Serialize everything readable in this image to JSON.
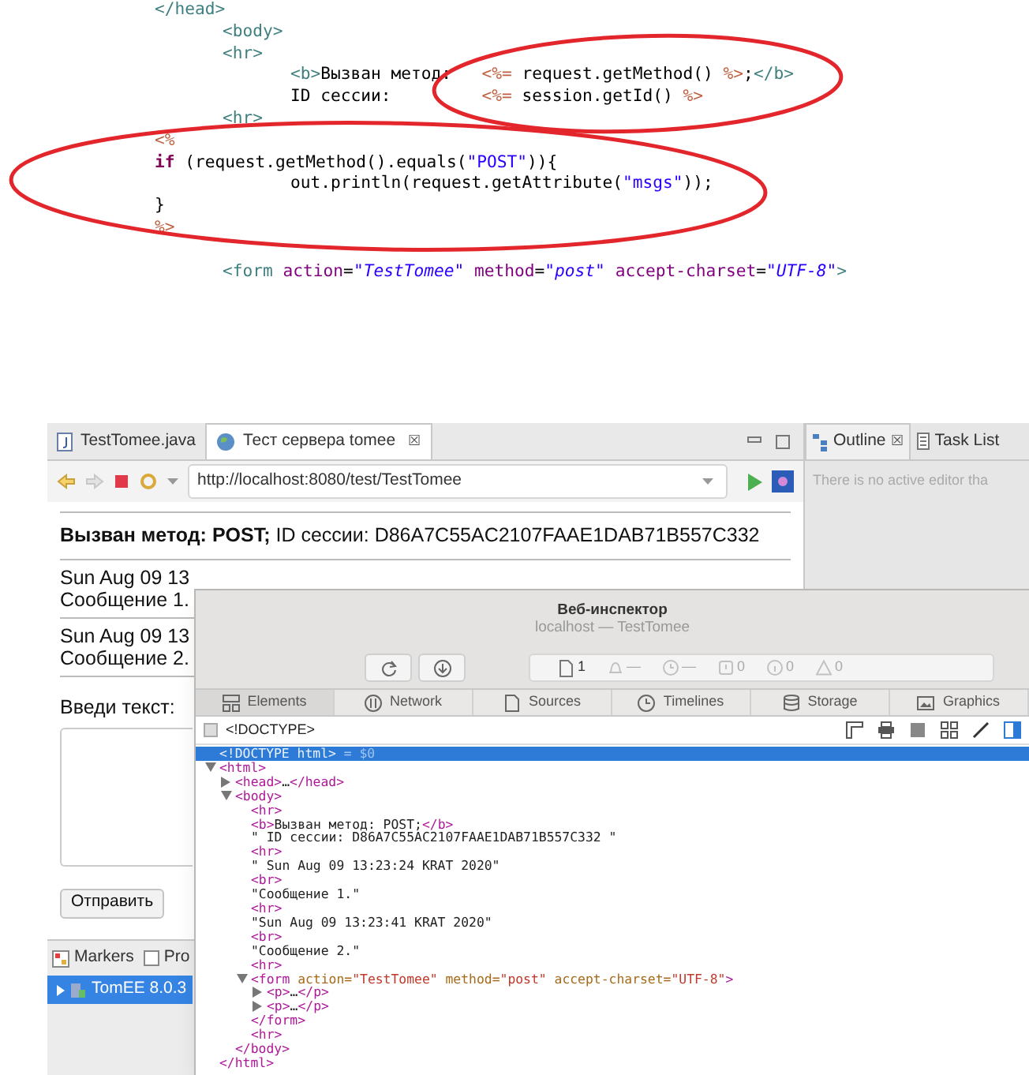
{
  "code_listing": {
    "lines": [
      {
        "tokens": [
          {
            "kind": "tag",
            "text": "</head>"
          }
        ]
      },
      {
        "tokens": [
          {
            "kind": "tag",
            "text": "\t<body>"
          }
        ]
      },
      {
        "tokens": [
          {
            "kind": "tag",
            "text": "\t<hr>"
          }
        ]
      },
      {
        "tokens": [
          {
            "kind": "tag",
            "text": "\t\t<b>"
          },
          {
            "kind": "plain",
            "text": "Вызван метод:   "
          },
          {
            "kind": "jsp",
            "text": "<%="
          },
          {
            "kind": "plain",
            "text": " request.getMethod() "
          },
          {
            "kind": "jsp",
            "text": "%>"
          },
          {
            "kind": "plain",
            "text": ";"
          },
          {
            "kind": "tag",
            "text": "</b>"
          }
        ]
      },
      {
        "tokens": [
          {
            "kind": "plain",
            "text": "\t\tID сессии:         "
          },
          {
            "kind": "jsp",
            "text": "<%="
          },
          {
            "kind": "plain",
            "text": " session.getId() "
          },
          {
            "kind": "jsp",
            "text": "%>"
          }
        ]
      },
      {
        "tokens": [
          {
            "kind": "tag",
            "text": "\t<hr>"
          }
        ]
      },
      {
        "tokens": [
          {
            "kind": "jsp",
            "text": "<%"
          }
        ]
      },
      {
        "tokens": [
          {
            "kind": "keyword",
            "text": "if"
          },
          {
            "kind": "plain",
            "text": " (request.getMethod().equals("
          },
          {
            "kind": "string",
            "text": "\"POST\""
          },
          {
            "kind": "plain",
            "text": ")){"
          }
        ]
      },
      {
        "tokens": [
          {
            "kind": "plain",
            "text": "\t\tout.println(request.getAttribute("
          },
          {
            "kind": "string",
            "text": "\"msgs\""
          },
          {
            "kind": "plain",
            "text": "));"
          }
        ]
      },
      {
        "tokens": [
          {
            "kind": "plain",
            "text": "}"
          }
        ]
      },
      {
        "tokens": [
          {
            "kind": "jsp",
            "text": "%>"
          }
        ]
      },
      {
        "gap_before": true,
        "tokens": [
          {
            "kind": "tag",
            "text": "\t<form"
          },
          {
            "kind": "attr",
            "text": " action"
          },
          {
            "kind": "plain",
            "text": "="
          },
          {
            "kind": "value",
            "text": "\"TestTomee\""
          },
          {
            "kind": "attr",
            "text": " method"
          },
          {
            "kind": "plain",
            "text": "="
          },
          {
            "kind": "value",
            "text": "\"post\""
          },
          {
            "kind": "attr",
            "text": " accept-charset"
          },
          {
            "kind": "plain",
            "text": "="
          },
          {
            "kind": "value",
            "text": "\"UTF-8\""
          },
          {
            "kind": "tag",
            "text": ">"
          }
        ]
      }
    ]
  },
  "editor": {
    "tabs": [
      {
        "label": "TestTomee.java",
        "selected": false
      },
      {
        "label": "Тест сервера tomee",
        "selected": true,
        "close": "☒"
      }
    ],
    "url": "http://localhost:8080/test/TestTomee",
    "page": {
      "heading": "**Вызван метод: POST;** ID сессии: D86A7C55AC2107FAAE1DAB71B557C332",
      "messages": [
        {
          "date": "Sun Aug 09 13",
          "text": "Сообщение 1."
        },
        {
          "date": "Sun Aug 09 13",
          "text": "Сообщение 2."
        }
      ],
      "input_label": "Введи текст:",
      "submit": "Отправить"
    }
  },
  "side_panel": {
    "tabs": [
      {
        "label": "Outline",
        "selected": true,
        "close": "☒"
      },
      {
        "label": "Task List",
        "selected": false
      }
    ],
    "message": "There is no active editor tha"
  },
  "bottom_panel": {
    "tabs": [
      {
        "label": "Markers"
      },
      {
        "label": "Pro"
      }
    ],
    "rows": [
      {
        "label": "TomEE 8.0.3",
        "selected": true
      }
    ]
  },
  "inspector": {
    "title": "Веб-инспектор",
    "subtitle": "localhost — TestTomee",
    "status": [
      {
        "kind": "doc",
        "text": "1",
        "dim": false
      },
      {
        "kind": "bell",
        "text": "—",
        "dim": true
      },
      {
        "kind": "clock",
        "text": "—",
        "dim": true
      },
      {
        "kind": "error",
        "text": "0",
        "dim": true
      },
      {
        "kind": "info",
        "text": "0",
        "dim": true
      },
      {
        "kind": "warn",
        "text": "0",
        "dim": true
      }
    ],
    "tabs": [
      {
        "label": "Elements",
        "selected": true
      },
      {
        "label": "Network",
        "selected": false
      },
      {
        "label": "Sources",
        "selected": false
      },
      {
        "label": "Timelines",
        "selected": false
      },
      {
        "label": "Storage",
        "selected": false
      },
      {
        "label": "Graphics",
        "selected": false
      }
    ],
    "breadcrumb": "<!DOCTYPE>",
    "tree": [
      {
        "selected": true,
        "tokens": [
          {
            "kind": "tag",
            "text": "<!DOCTYPE html>"
          },
          {
            "kind": "note",
            "text": " = $0"
          }
        ]
      },
      {
        "selected": false,
        "expanded": true,
        "tokens": [
          {
            "kind": "tag",
            "text": "<html>"
          }
        ],
        "closing": "</html>",
        "children": [
          {
            "selected": false,
            "expanded": false,
            "tokens": [
              {
                "kind": "tag",
                "text": "<head>"
              },
              {
                "kind": "text",
                "text": "…"
              },
              {
                "kind": "tag",
                "text": "</head>"
              }
            ]
          },
          {
            "selected": false,
            "expanded": true,
            "tokens": [
              {
                "kind": "tag",
                "text": "<body>"
              }
            ],
            "closing": "</body>",
            "children": [
              {
                "selected": false,
                "tokens": [
                  {
                    "kind": "tag",
                    "text": "<hr>"
                  }
                ]
              },
              {
                "selected": false,
                "tokens": [
                  {
                    "kind": "tag",
                    "text": "<b>"
                  },
                  {
                    "kind": "text",
                    "text": "Вызван метод: POST;"
                  },
                  {
                    "kind": "tag",
                    "text": "</b>"
                  }
                ]
              },
              {
                "selected": false,
                "tokens": [
                  {
                    "kind": "text",
                    "text": "\" ID сессии: D86A7C55AC2107FAAE1DAB71B557C332 \""
                  }
                ]
              },
              {
                "selected": false,
                "tokens": [
                  {
                    "kind": "tag",
                    "text": "<hr>"
                  }
                ]
              },
              {
                "selected": false,
                "tokens": [
                  {
                    "kind": "text",
                    "text": "\" Sun Aug 09 13:23:24 KRAT 2020\""
                  }
                ]
              },
              {
                "selected": false,
                "tokens": [
                  {
                    "kind": "tag",
                    "text": "<br>"
                  }
                ]
              },
              {
                "selected": false,
                "tokens": [
                  {
                    "kind": "text",
                    "text": "\"Сообщение 1.\""
                  }
                ]
              },
              {
                "selected": false,
                "tokens": [
                  {
                    "kind": "tag",
                    "text": "<hr>"
                  }
                ]
              },
              {
                "selected": false,
                "tokens": [
                  {
                    "kind": "text",
                    "text": "\"Sun Aug 09 13:23:41 KRAT 2020\""
                  }
                ]
              },
              {
                "selected": false,
                "tokens": [
                  {
                    "kind": "tag",
                    "text": "<br>"
                  }
                ]
              },
              {
                "selected": false,
                "tokens": [
                  {
                    "kind": "text",
                    "text": "\"Сообщение 2.\""
                  }
                ]
              },
              {
                "selected": false,
                "tokens": [
                  {
                    "kind": "tag",
                    "text": "<hr>"
                  }
                ]
              },
              {
                "selected": false,
                "expanded": true,
                "tokens": [
                  {
                    "kind": "tag",
                    "text": "<form "
                  },
                  {
                    "kind": "attr",
                    "text": "action="
                  },
                  {
                    "kind": "value",
                    "text": "\"TestTomee\""
                  },
                  {
                    "kind": "attr",
                    "text": " method="
                  },
                  {
                    "kind": "value",
                    "text": "\"post\""
                  },
                  {
                    "kind": "attr",
                    "text": " accept-charset="
                  },
                  {
                    "kind": "value",
                    "text": "\"UTF-8\""
                  },
                  {
                    "kind": "tag",
                    "text": ">"
                  }
                ],
                "closing": "</form>",
                "children": [
                  {
                    "selected": false,
                    "expanded": false,
                    "tokens": [
                      {
                        "kind": "tag",
                        "text": "<p>"
                      },
                      {
                        "kind": "text",
                        "text": "…"
                      },
                      {
                        "kind": "tag",
                        "text": "</p>"
                      }
                    ]
                  },
                  {
                    "selected": false,
                    "expanded": false,
                    "tokens": [
                      {
                        "kind": "tag",
                        "text": "<p>"
                      },
                      {
                        "kind": "text",
                        "text": "…"
                      },
                      {
                        "kind": "tag",
                        "text": "</p>"
                      }
                    ]
                  }
                ]
              },
              {
                "selected": false,
                "tokens": [
                  {
                    "kind": "tag",
                    "text": "<hr>"
                  }
                ]
              }
            ]
          }
        ]
      }
    ]
  }
}
